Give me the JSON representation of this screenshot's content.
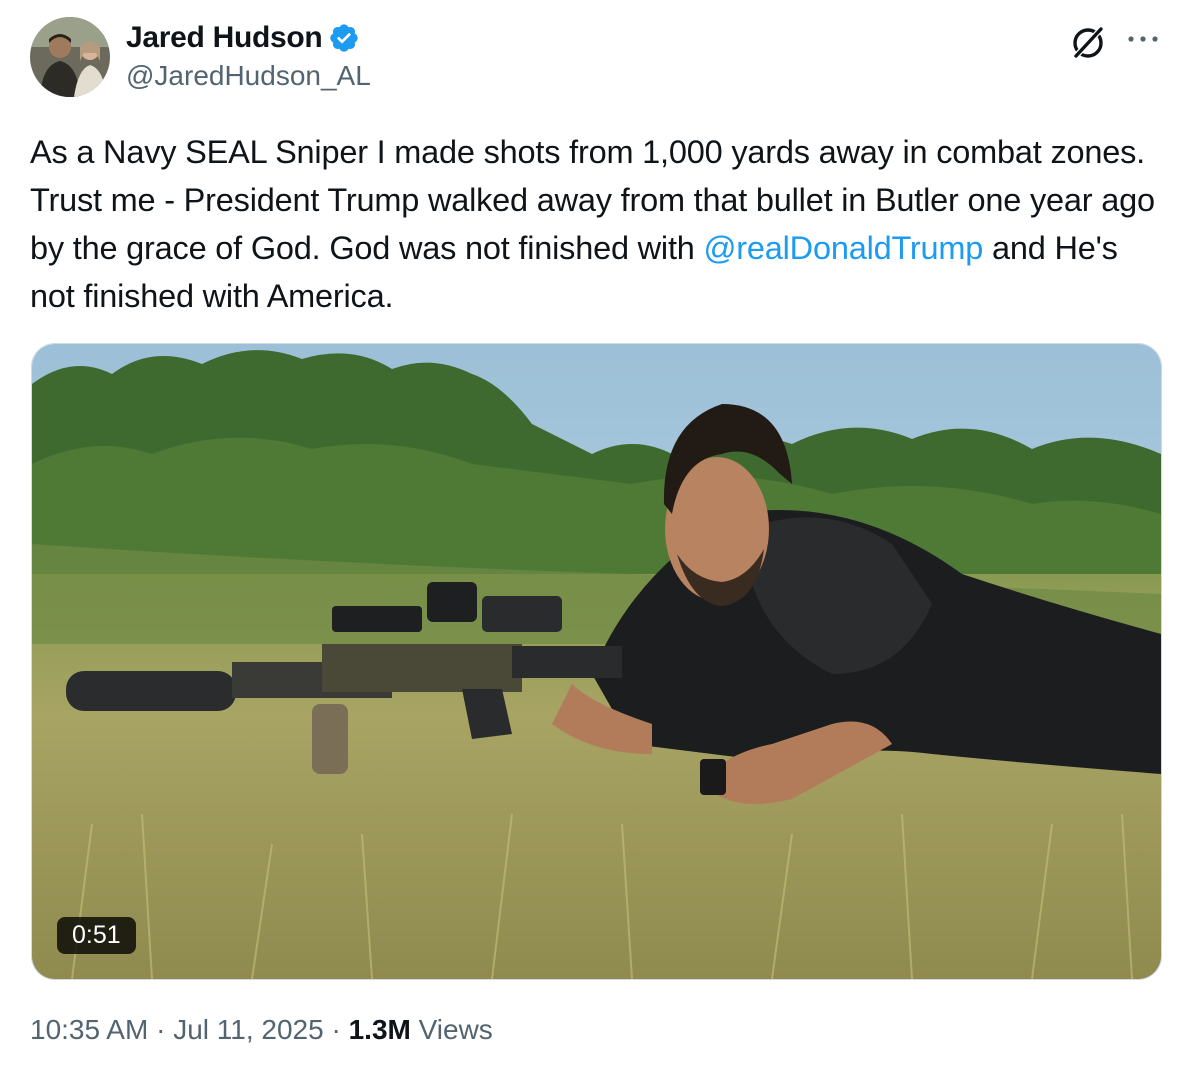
{
  "author": {
    "display_name": "Jared Hudson",
    "handle": "@JaredHudson_AL",
    "verified": true,
    "verified_color": "#1d9bf0"
  },
  "icons": {
    "grok": "grok-icon",
    "more": "more-horizontal-icon",
    "verified": "verified-badge-icon"
  },
  "tweet": {
    "text_before_mention": "As a Navy SEAL Sniper I made shots from 1,000 yards away in combat zones. Trust me - President Trump walked away from that bullet in Butler one year ago by the grace of God. God was not finished with ",
    "mention": "@realDonaldTrump",
    "text_after_mention": " and He's not finished with America.",
    "mention_color": "#1d9bf0"
  },
  "media": {
    "type": "video",
    "duration": "0:51"
  },
  "meta": {
    "time": "10:35 AM",
    "separator": " · ",
    "date": "Jul 11, 2025",
    "views_count": "1.3M",
    "views_label": " Views"
  }
}
